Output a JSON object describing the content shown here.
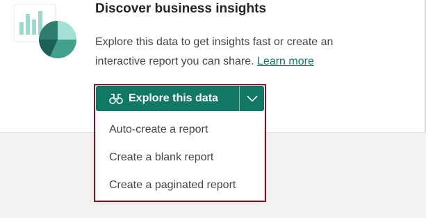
{
  "card": {
    "icon": "report-insights-icon",
    "title": "Discover business insights",
    "description": "Explore this data to get insights fast or create an interactive report you can share.",
    "learn_more": "Learn more"
  },
  "explore_button": {
    "icon": "binoculars-icon",
    "label": "Explore this data",
    "dropdown_icon": "chevron-down-icon"
  },
  "menu": {
    "items": [
      {
        "label": "Auto-create a report"
      },
      {
        "label": "Create a blank report"
      },
      {
        "label": "Create a paginated report"
      }
    ]
  },
  "colors": {
    "accent": "#117865",
    "highlight_border": "#7a1b2b",
    "text": "#484644",
    "title": "#252423"
  }
}
